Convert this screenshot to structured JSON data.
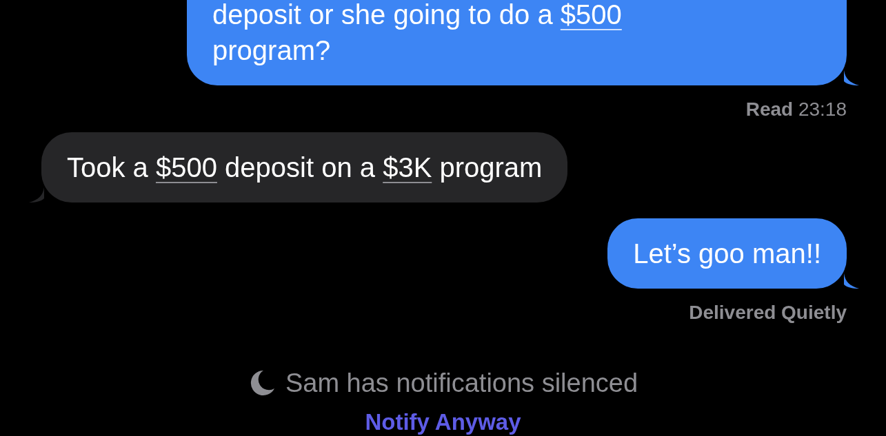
{
  "messages": [
    {
      "kind": "sent",
      "lines": [
        [
          {
            "text": "deposit or she going to do a "
          },
          {
            "text": "$500",
            "kind": "link"
          }
        ],
        [
          {
            "text": "program?"
          }
        ]
      ],
      "status_label": "Read",
      "status_time": "23:18"
    },
    {
      "kind": "received",
      "lines": [
        [
          {
            "text": "Took a "
          },
          {
            "text": "$500",
            "kind": "link"
          },
          {
            "text": " deposit on a "
          },
          {
            "text": "$3K",
            "kind": "link"
          },
          {
            "text": " program"
          }
        ]
      ]
    },
    {
      "kind": "sent",
      "lines": [
        [
          {
            "text": "Let’s goo man!!"
          }
        ]
      ],
      "status_label": "Delivered Quietly"
    }
  ],
  "notice": {
    "text": "Sam has notifications silenced",
    "action": "Notify Anyway"
  }
}
